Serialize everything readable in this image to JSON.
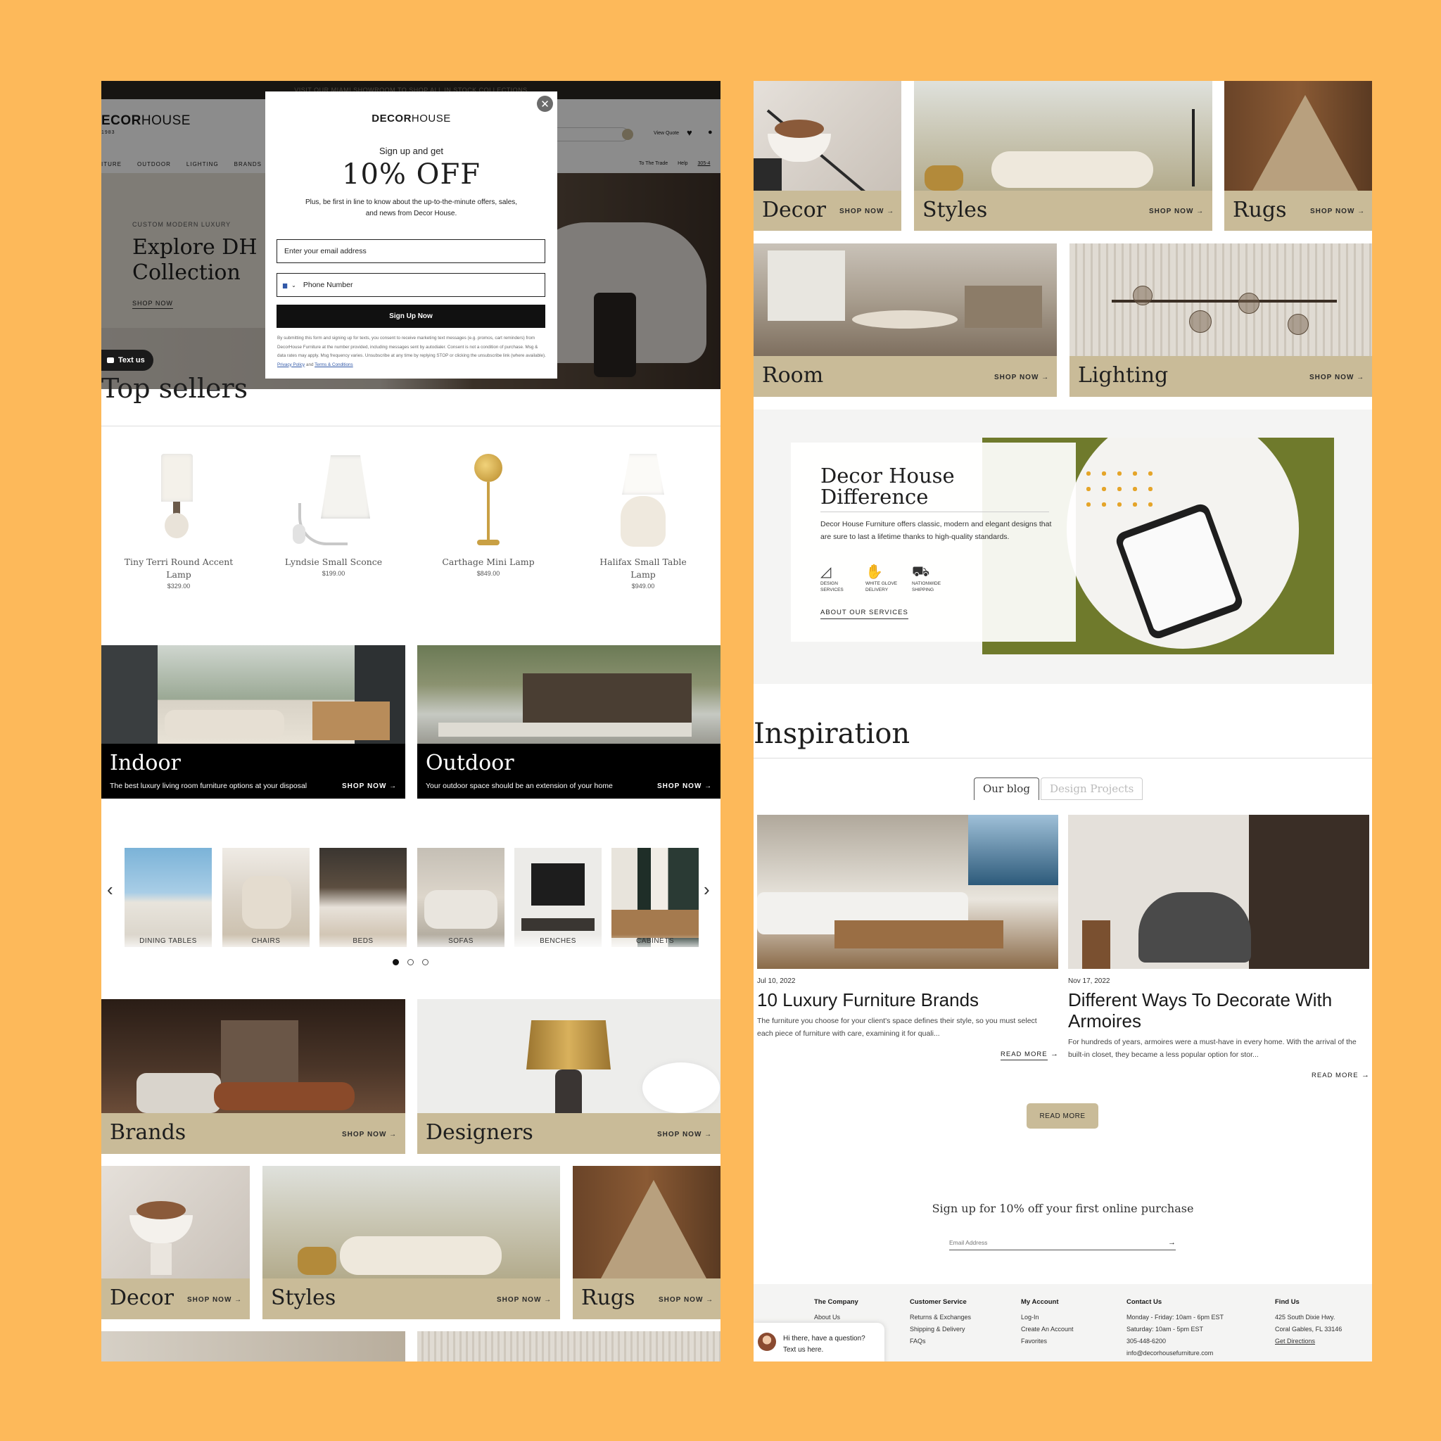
{
  "left": {
    "announcement": "VISIT OUR MIAMI SHOWROOM TO SHOP ALL IN STOCK COLLECTIONS",
    "logo": {
      "bold": "ECOR",
      "light": "HOUSE",
      "sub": "1983"
    },
    "header_links": {
      "quote": "View Quote",
      "trade": "To The Trade",
      "help": "Help",
      "phone": "305-4"
    },
    "nav": [
      "ITURE",
      "OUTDOOR",
      "LIGHTING",
      "BRANDS"
    ],
    "hero": {
      "eyebrow": "CUSTOM MODERN LUXURY",
      "title_line1": "Explore DH",
      "title_line2": "Collection",
      "cta": "SHOP NOW"
    },
    "text_us": "Text us",
    "top_sellers": "Top sellers",
    "products": [
      {
        "name": "Tiny Terri Round Accent Lamp",
        "price": "$329.00"
      },
      {
        "name": "Lyndsie Small Sconce",
        "price": "$199.00"
      },
      {
        "name": "Carthage Mini Lamp",
        "price": "$849.00"
      },
      {
        "name": "Halifax Small Table Lamp",
        "price": "$949.00"
      }
    ],
    "feature_tiles": [
      {
        "title": "Indoor",
        "desc": "The best luxury living room furniture options at your disposal",
        "cta": "SHOP NOW →"
      },
      {
        "title": "Outdoor",
        "desc": "Your outdoor space should be an extension of your home",
        "cta": "SHOP NOW →"
      }
    ],
    "categories": [
      "DINING TABLES",
      "CHAIRS",
      "BEDS",
      "SOFAS",
      "BENCHES",
      "CABINETS"
    ],
    "tiles_row1": [
      {
        "title": "Brands",
        "cta": "SHOP NOW →"
      },
      {
        "title": "Designers",
        "cta": "SHOP NOW →"
      }
    ],
    "tiles_row2": [
      {
        "title": "Decor",
        "cta": "SHOP NOW →"
      },
      {
        "title": "Styles",
        "cta": "SHOP NOW →"
      },
      {
        "title": "Rugs",
        "cta": "SHOP NOW →"
      }
    ]
  },
  "modal": {
    "logo_bold": "DECOR",
    "logo_light": "HOUSE",
    "lead": "Sign up and get",
    "offer": "10% OFF",
    "sub": "Plus, be first in line to know about the up-to-the-minute offers, sales, and news from Decor House.",
    "email_placeholder": "Enter your email address",
    "phone_placeholder": "Phone Number",
    "submit": "Sign Up Now",
    "legal": "By submitting this form and signing up for texts, you consent to receive marketing text messages (e.g. promos, cart reminders) from DecorHouse Furniture at the number provided, including messages sent by autodialer. Consent is not a condition of purchase. Msg & data rates may apply. Msg frequency varies. Unsubscribe at any time by replying STOP or clicking the unsubscribe link (where available).",
    "privacy": "Privacy Policy",
    "and": "and",
    "terms": "Terms & Conditions"
  },
  "right": {
    "tiles_top": [
      {
        "title": "Decor",
        "cta": "SHOP NOW →"
      },
      {
        "title": "Styles",
        "cta": "SHOP NOW →"
      },
      {
        "title": "Rugs",
        "cta": "SHOP NOW →"
      }
    ],
    "tiles_mid": [
      {
        "title": "Room",
        "cta": "SHOP NOW →"
      },
      {
        "title": "Lighting",
        "cta": "SHOP NOW →"
      }
    ],
    "difference": {
      "title_line1": "Decor House",
      "title_line2": "Difference",
      "body": "Decor House Furniture offers classic, modern and elegant designs that are sure to last a lifetime thanks to high-quality standards.",
      "features": [
        {
          "line1": "DESIGN",
          "line2": "SERVICES"
        },
        {
          "line1": "WHITE GLOVE",
          "line2": "DELIVERY"
        },
        {
          "line1": "NATIONWIDE",
          "line2": "SHIPPING"
        }
      ],
      "link": "ABOUT OUR SERVICES"
    },
    "inspiration": "Inspiration",
    "tabs": [
      "Our blog",
      "Design Projects"
    ],
    "posts": [
      {
        "date": "Jul 10, 2022",
        "title": "10 Luxury Furniture Brands",
        "excerpt": "The furniture you choose for your client's space defines their style, so you must select each piece of furniture with care, examining it for quali...",
        "cta": "READ MORE"
      },
      {
        "date": "Nov 17, 2022",
        "title": "Different Ways To Decorate With Armoires",
        "excerpt": "For hundreds of years, armoires were a must-have in every home. With the arrival of the built-in closet, they became a less popular option for stor...",
        "cta": "READ MORE"
      }
    ],
    "read_more_btn": "READ MORE",
    "signup_title": "Sign up for 10% off your first online purchase",
    "email_placeholder": "Email Address",
    "footer": [
      {
        "heading": "The Company",
        "items": [
          "About Us"
        ]
      },
      {
        "heading": "Customer Service",
        "items": [
          "Returns & Exchanges",
          "Shipping & Delivery",
          "FAQs"
        ]
      },
      {
        "heading": "My Account",
        "items": [
          "Log-In",
          "Create An Account",
          "Favorites"
        ]
      },
      {
        "heading": "Contact Us",
        "items": [
          "Monday - Friday: 10am - 6pm EST",
          "Saturday: 10am - 5pm EST",
          "305-448-6200",
          "info@decorhousefurniture.com"
        ]
      },
      {
        "heading": "Find Us",
        "items": [
          "425 South Dixie Hwy.",
          "Coral Gables, FL 33146",
          "Get Directions"
        ]
      }
    ],
    "chat": "Hi there, have a question? Text us here."
  },
  "colors": {
    "background": "#fdb95a",
    "tan": "#c9bb98",
    "black": "#000000",
    "modal_button": "#111111"
  }
}
